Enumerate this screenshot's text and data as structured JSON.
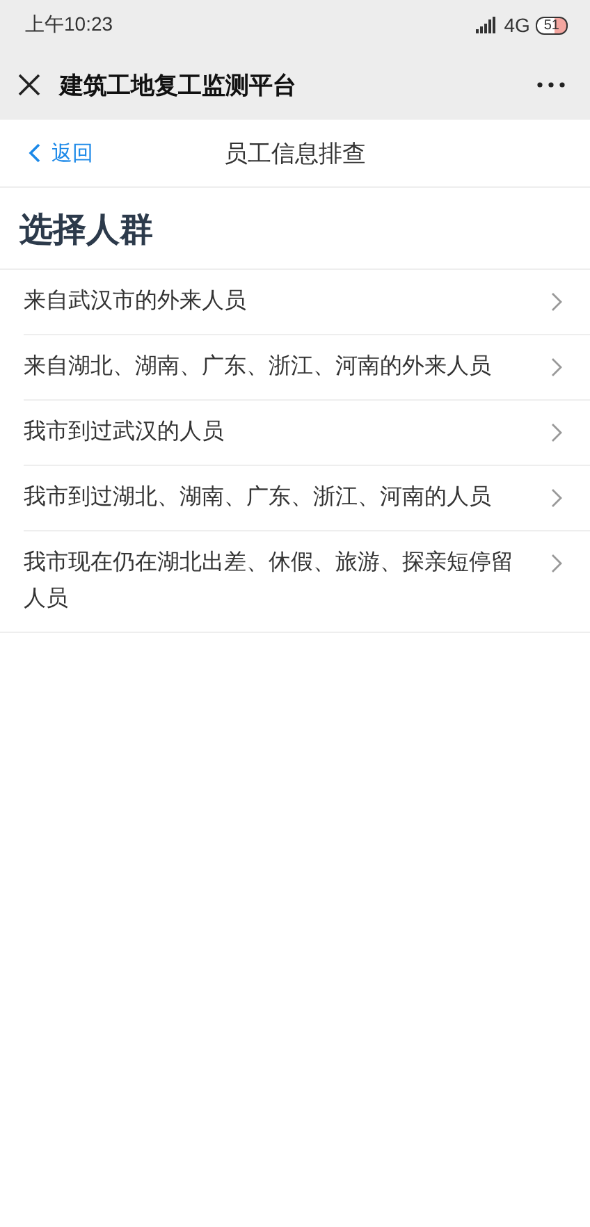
{
  "status_bar": {
    "time": "上午10:23",
    "network": "4G",
    "battery": "51"
  },
  "header": {
    "title": "建筑工地复工监测平台"
  },
  "nav": {
    "back": "返回",
    "title": "员工信息排查"
  },
  "section_title": "选择人群",
  "items": [
    {
      "label": "来自武汉市的外来人员"
    },
    {
      "label": "来自湖北、湖南、广东、浙江、河南的外来人员"
    },
    {
      "label": "我市到过武汉的人员"
    },
    {
      "label": "我市到过湖北、湖南、广东、浙江、河南的人员"
    },
    {
      "label": "我市现在仍在湖北出差、休假、旅游、探亲短停留人员"
    }
  ]
}
